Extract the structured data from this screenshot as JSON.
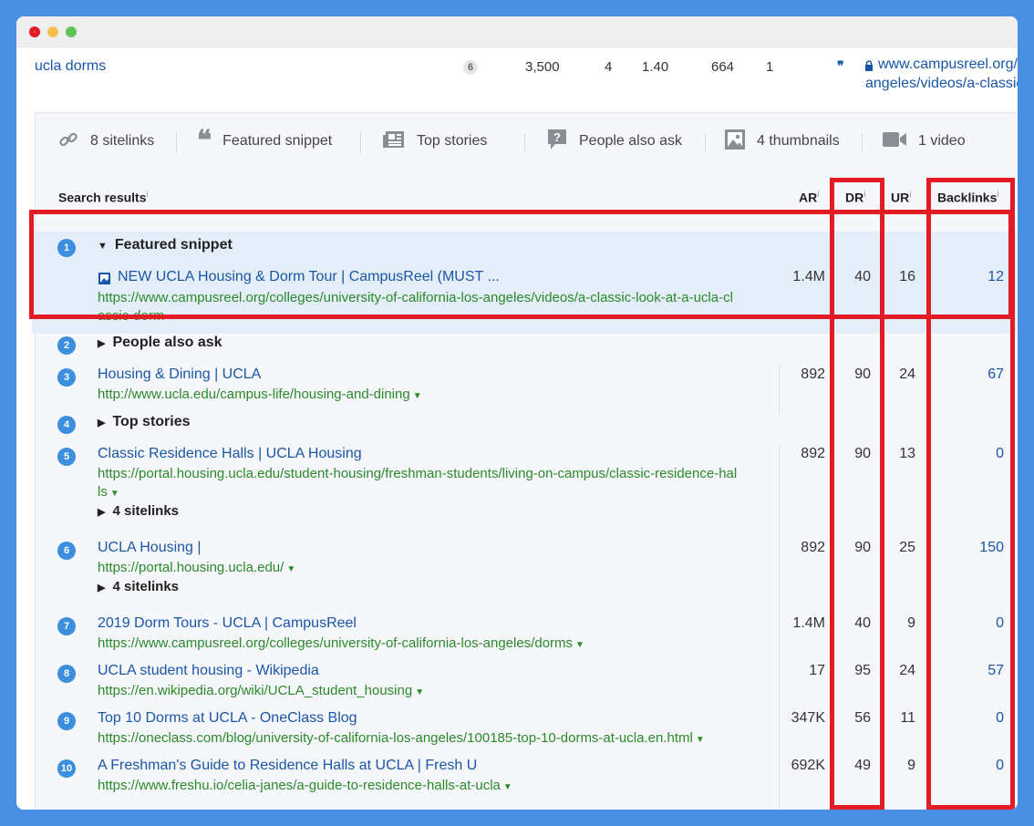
{
  "keyword_row": {
    "keyword": "ucla dorms",
    "badge": "6",
    "volume": "3,500",
    "kd": "4",
    "cpc": "1.40",
    "traffic": "664",
    "parent": "1",
    "url_line1": "www.campusreel.org/c",
    "url_line2": "angeles/videos/a-classic"
  },
  "features": [
    {
      "icon": "link-icon",
      "label": "8 sitelinks"
    },
    {
      "icon": "quote-icon",
      "label": "Featured snippet"
    },
    {
      "icon": "newspaper-icon",
      "label": "Top stories"
    },
    {
      "icon": "question-icon",
      "label": "People also ask"
    },
    {
      "icon": "image-icon",
      "label": "4 thumbnails"
    },
    {
      "icon": "video-icon",
      "label": "1 video"
    }
  ],
  "headers": {
    "search_results": "Search results",
    "ar": "AR",
    "dr": "DR",
    "ur": "UR",
    "backlinks": "Backlinks",
    "info": "i"
  },
  "results": [
    {
      "n": "1",
      "section": "Featured snippet",
      "title": "NEW UCLA Housing & Dorm Tour | CampusReel (MUST ...",
      "url1": "https://www.campusreel.org/colleges/university-of-california-los-angeles/videos/a-classic-look-at-a-ucla-cl",
      "url2": "assic-dorm",
      "ar": "1.4M",
      "dr": "40",
      "ur": "16",
      "bl": "12"
    },
    {
      "n": "2",
      "section": "People also ask"
    },
    {
      "n": "3",
      "title": "Housing & Dining | UCLA",
      "url1": "http://www.ucla.edu/campus-life/housing-and-dining",
      "ar": "892",
      "dr": "90",
      "ur": "24",
      "bl": "67"
    },
    {
      "n": "4",
      "section": "Top stories"
    },
    {
      "n": "5",
      "title": "Classic Residence Halls | UCLA Housing",
      "url1": "https://portal.housing.ucla.edu/student-housing/freshman-students/living-on-campus/classic-residence-hal",
      "url2": "ls",
      "sub": "4 sitelinks",
      "ar": "892",
      "dr": "90",
      "ur": "13",
      "bl": "0"
    },
    {
      "n": "6",
      "title": "UCLA Housing |",
      "url1": "https://portal.housing.ucla.edu/",
      "sub": "4 sitelinks",
      "ar": "892",
      "dr": "90",
      "ur": "25",
      "bl": "150"
    },
    {
      "n": "7",
      "title": "2019 Dorm Tours - UCLA | CampusReel",
      "url1": "https://www.campusreel.org/colleges/university-of-california-los-angeles/dorms",
      "ar": "1.4M",
      "dr": "40",
      "ur": "9",
      "bl": "0"
    },
    {
      "n": "8",
      "title": "UCLA student housing - Wikipedia",
      "url1": "https://en.wikipedia.org/wiki/UCLA_student_housing",
      "ar": "17",
      "dr": "95",
      "ur": "24",
      "bl": "57"
    },
    {
      "n": "9",
      "title": "Top 10 Dorms at UCLA - OneClass Blog",
      "url1": "https://oneclass.com/blog/university-of-california-los-angeles/100185-top-10-dorms-at-ucla.en.html",
      "ar": "347K",
      "dr": "56",
      "ur": "11",
      "bl": "0"
    },
    {
      "n": "10",
      "title": "A Freshman's Guide to Residence Halls at UCLA | Fresh U",
      "url1": "https://www.freshu.io/celia-janes/a-guide-to-residence-halls-at-ucla",
      "ar": "692K",
      "dr": "49",
      "ur": "9",
      "bl": "0"
    }
  ],
  "colors": {
    "accent": "#1a56a8",
    "url": "#2a8a2a",
    "highlight_box": "#e21b24",
    "background": "#4a90e2"
  }
}
